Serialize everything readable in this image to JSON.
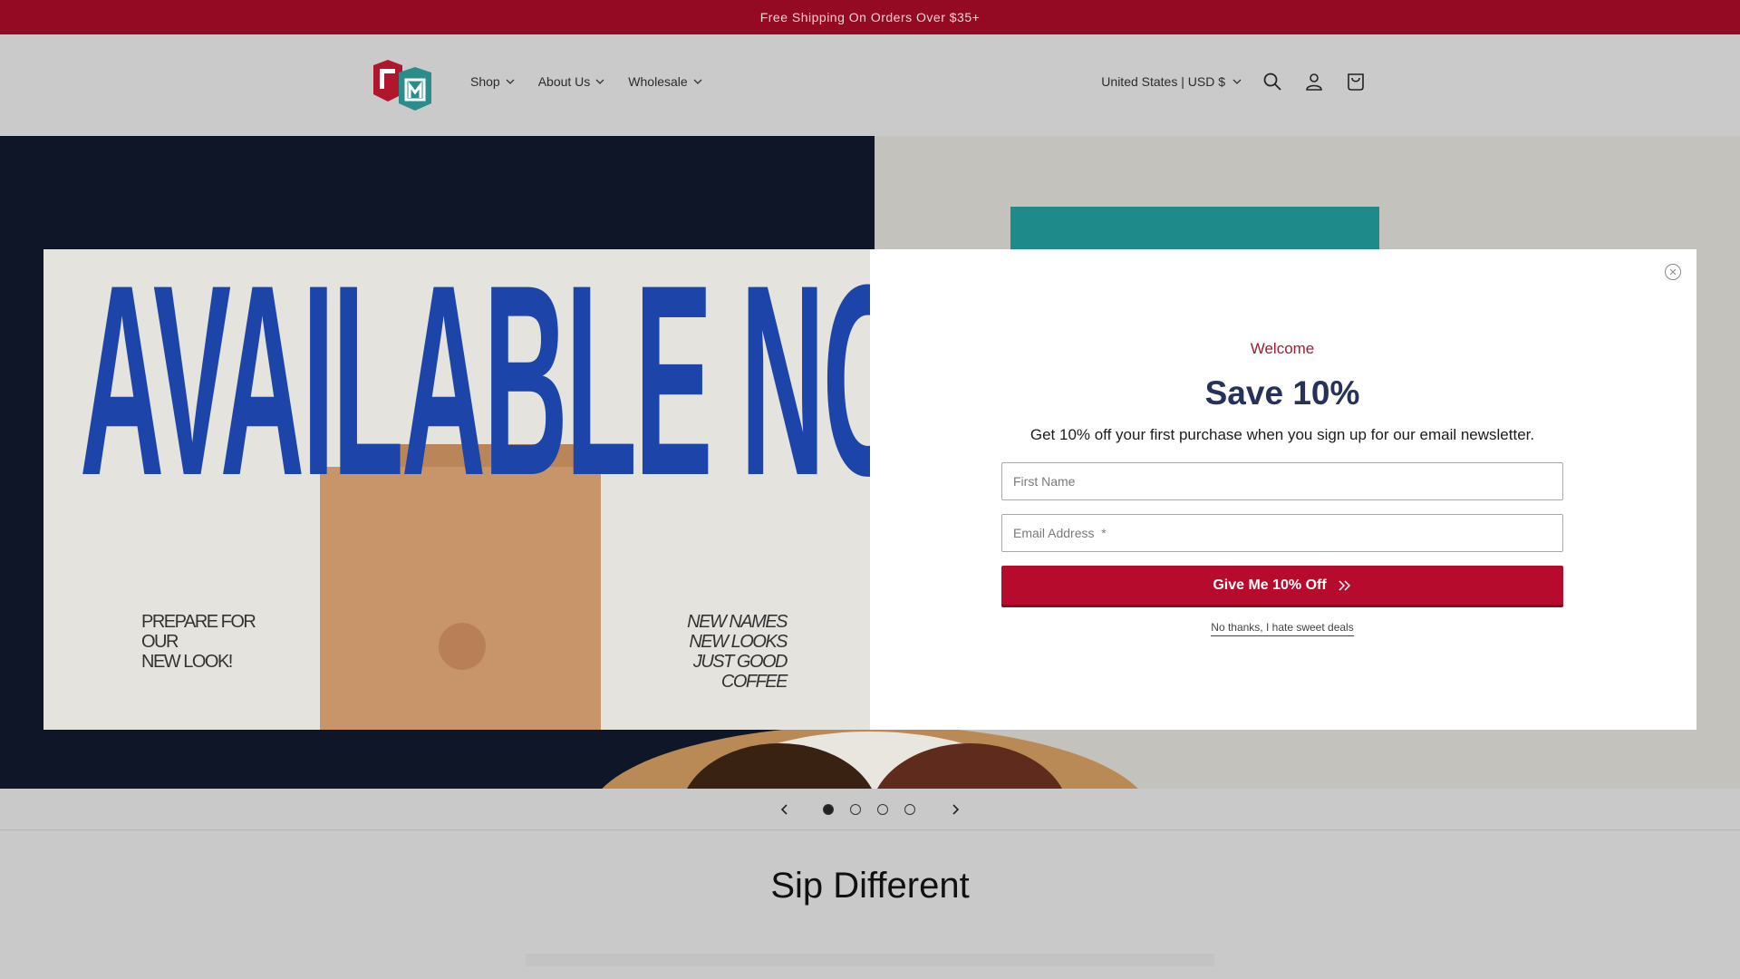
{
  "announcement": {
    "text": "Free Shipping On Orders Over $35+"
  },
  "header": {
    "nav": [
      {
        "label": "Shop"
      },
      {
        "label": "About Us"
      },
      {
        "label": "Wholesale"
      }
    ],
    "country_selector": "United States | USD $",
    "icons": [
      "search-icon",
      "account-icon",
      "cart-icon"
    ]
  },
  "slider": {
    "slide_count": 4,
    "active_slide": 1
  },
  "section": {
    "title": "Sip Different"
  },
  "popup": {
    "image_headline": "AVAILABLE NOW",
    "image_text_left": [
      "PREPARE FOR",
      "OUR",
      "NEW LOOK!"
    ],
    "image_text_right": [
      "NEW NAMES",
      "NEW LOOKS",
      "JUST GOOD",
      "COFFEE"
    ],
    "eyebrow": "Welcome",
    "title": "Save 10%",
    "subtitle": "Get 10% off your first purchase when you sign up for our email newsletter.",
    "first_name_placeholder": "First Name",
    "email_placeholder": "Email Address  *",
    "cta_label": "Give Me 10% Off",
    "decline_label": "No thanks, I hate sweet deals"
  },
  "colors": {
    "announcement_bg": "#930a22",
    "accent_red": "#b60b2c",
    "navy": "#27325a",
    "teal": "#1e8a89",
    "headline_blue": "#1d44a8"
  }
}
